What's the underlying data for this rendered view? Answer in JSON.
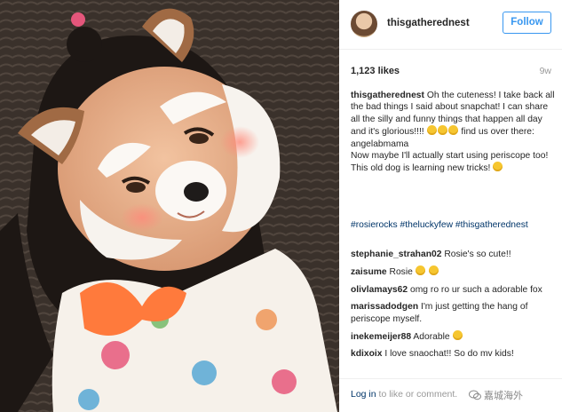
{
  "post": {
    "username": "thisgatherednest",
    "follow_label": "Follow",
    "likes": "1,123 likes",
    "age": "9w",
    "caption": {
      "username": "thisgatherednest",
      "text_1": "Oh the cuteness! I take back all the bad things I said about snapchat! I can share all the silly and funny things that happen all day and it's glorious!!!!",
      "text_2": "find us over there: angelabmama",
      "text_3": "Now maybe I'll actually start using periscope too! This old dog is learning new tricks!"
    },
    "hashtags": "#rosierocks #theluckyfew #thisgatherednest"
  },
  "comments": [
    {
      "user": "stephanie_strahan02",
      "text": "Rosie's so cute!!"
    },
    {
      "user": "zaisume",
      "text": "Rosie"
    },
    {
      "user": "olivlamays62",
      "text": "omg ro ro ur such a adorable fox"
    },
    {
      "user": "marissadodgen",
      "text": "I'm just getting the hang of periscope myself."
    },
    {
      "user": "inekemeijer88",
      "text": "Adorable"
    },
    {
      "user": "kdixoix",
      "text": "I love snaochat!! So do mv kids!"
    }
  ],
  "footer": {
    "login_link": "Log in",
    "login_rest": "to like or comment.",
    "watermark": "嘉城海外"
  },
  "icons": {
    "emoji": "smiling-face-icon",
    "watermark": "wechat-icon"
  }
}
